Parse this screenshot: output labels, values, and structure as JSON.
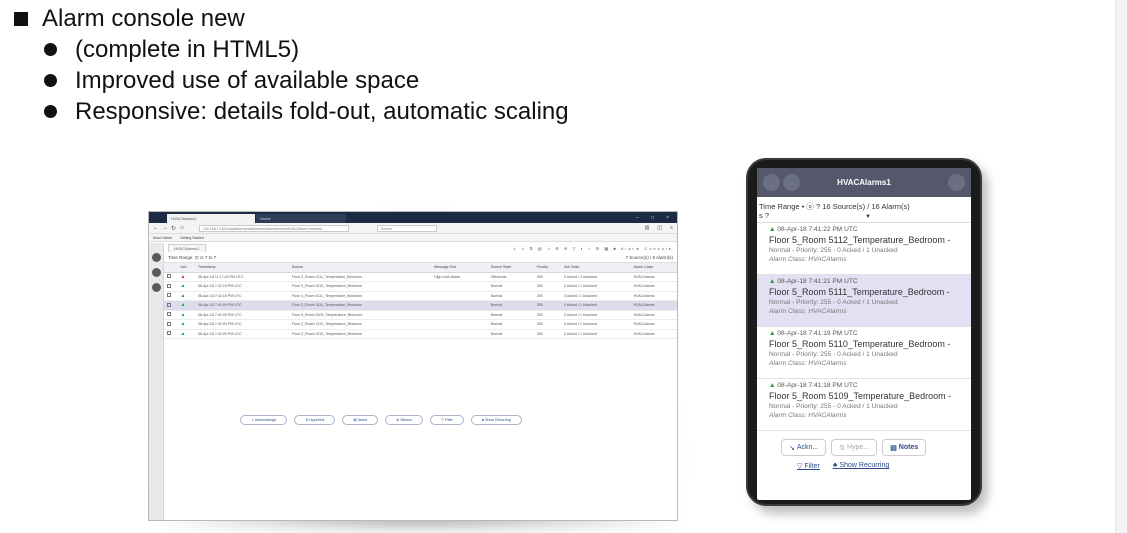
{
  "bullets": {
    "main": "Alarm console new",
    "subs": [
      "(complete in HTML5)",
      "Improved use of available space",
      "Responsive: details fold-out, automatic scaling"
    ]
  },
  "desktop": {
    "tab1": "HVACAlarms1",
    "tab2": "Home",
    "url": "192.168.1.140/vsdplatform/pwls/fbrkanv/AlarmServive/HVACAlarms?vieweal",
    "search_placeholder": "Search",
    "bookmarks": [
      "Most Visited",
      "Getting Started"
    ],
    "app_tab": "HVACAlarms1",
    "app_right": "Alarm Console",
    "time_range_label": "Time Range",
    "time_count": "7 to 7",
    "source_summary": "7 Source(s) / 9 Alarm(s)",
    "columns": [
      "",
      "Info",
      "Timestamp",
      "Source",
      "Message Text",
      "Source State",
      "Priority",
      "Ack State",
      "Alarm Class"
    ],
    "rows": [
      {
        "icon": "red",
        "ts": "08-Apr-18 11:17:40 PM UTC",
        "src": "Floor 2_Room 2111_Temperature_Bedroom",
        "msg": "High Limit Alarm",
        "state": "Offnormal",
        "pri": "255",
        "ack": "0 Acked / 3 Unacked",
        "cls": "HVACAlarms",
        "sel": false
      },
      {
        "icon": "green",
        "ts": "08-Apr-18 7:41:19 PM UTC",
        "src": "Floor 5_Room 5110_Temperature_Bedroom",
        "msg": "",
        "state": "Normal",
        "pri": "255",
        "ack": "0 Acked / 1 Unacked",
        "cls": "HVACAlarms",
        "sel": false
      },
      {
        "icon": "green",
        "ts": "08-Apr-18 7:41:18 PM UTC",
        "src": "Floor 4_Room 4111_Temperature_Bedroom",
        "msg": "",
        "state": "Normal",
        "pri": "255",
        "ack": "0 Acked / 1 Unacked",
        "cls": "HVACAlarms",
        "sel": false
      },
      {
        "icon": "green",
        "ts": "08-Apr-18 7:41:09 PM UTC",
        "src": "Floor 3_Room 3111_Temperature_Bedroom",
        "msg": "",
        "state": "Normal",
        "pri": "255",
        "ack": "0 Acked / 1 Unacked",
        "cls": "HVACAlarms",
        "sel": true
      },
      {
        "icon": "green",
        "ts": "08-Apr-18 7:41:05 PM UTC",
        "src": "Floor 5_Room 5109_Temperature_Bedroom",
        "msg": "",
        "state": "Normal",
        "pri": "255",
        "ack": "0 Acked / 1 Unacked",
        "cls": "HVACAlarms",
        "sel": false
      },
      {
        "icon": "green",
        "ts": "08-Apr-18 7:41:04 PM UTC",
        "src": "Floor 2_Room 2112_Temperature_Bedroom",
        "msg": "",
        "state": "Normal",
        "pri": "255",
        "ack": "0 Acked / 1 Unacked",
        "cls": "HVACAlarms",
        "sel": false
      },
      {
        "icon": "green",
        "ts": "08-Apr-18 7:41:00 PM UTC",
        "src": "Floor 2_Room 2110_Temperature_Bedroom",
        "msg": "",
        "state": "Normal",
        "pri": "255",
        "ack": "0 Acked / 1 Unacked",
        "cls": "HVACAlarms",
        "sel": false
      }
    ],
    "buttons": [
      "Acknowledge",
      "Hyperlink",
      "Notes",
      "Silence",
      "Filter",
      "Show Recurring"
    ]
  },
  "tablet": {
    "title": "HVACAlarms1",
    "filter_line1": "Time Range   •   ⓞ  ?   16 Source(s) / 16 Alarm(s)",
    "filter_line2": "s ?",
    "items": [
      {
        "ts": "08-Apr-18 7:41:22 PM UTC",
        "src": "Floor 5_Room 5112_Temperature_Bedroom -",
        "state": "Normal - Priority: 255 - 0 Acked / 1 Unacked",
        "cls": "Alarm Class: HVACAlarms",
        "sel": false
      },
      {
        "ts": "08-Apr-18 7:41:21 PM UTC",
        "src": "Floor 5_Room 5111_Temperature_Bedroom -",
        "state": "Normal - Priority: 255 - 0 Acked / 1 Unacked",
        "cls": "Alarm Class: HVACAlarms",
        "sel": true
      },
      {
        "ts": "08-Apr-18 7:41:19 PM UTC",
        "src": "Floor 5_Room 5110_Temperature_Bedroom -",
        "state": "Normal - Priority: 255 - 0 Acked / 1 Unacked",
        "cls": "Alarm Class: HVACAlarms",
        "sel": false
      },
      {
        "ts": "08-Apr-18 7:41:18 PM UTC",
        "src": "Floor 5_Room 5109_Temperature_Bedroom -",
        "state": "Normal - Priority: 255 - 0 Acked / 1 Unacked",
        "cls": "Alarm Class: HVACAlarms",
        "sel": false
      }
    ],
    "buttons": [
      "Ackn...",
      "Hype...",
      "Notes"
    ],
    "buttons2": [
      "Filter",
      "Show Recurring"
    ]
  },
  "colors": {
    "browser_tabbar": "#1c2b44",
    "tablet_header": "#55586b",
    "selected_row": "#dcdcec",
    "green_icon": "#2a9a3a",
    "red_icon": "#d22222"
  }
}
